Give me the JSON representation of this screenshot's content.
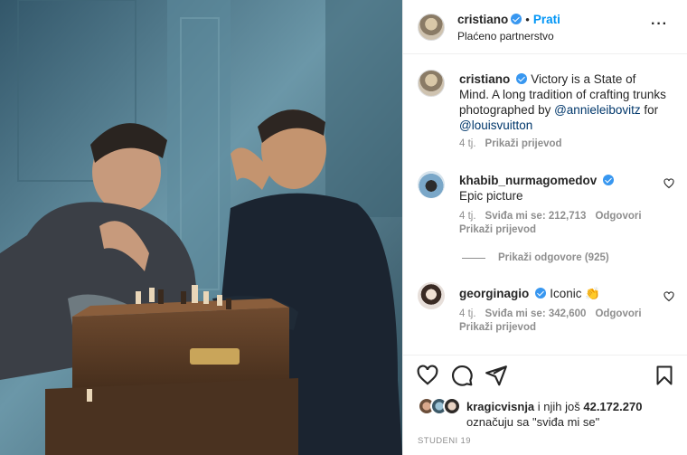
{
  "photo": {
    "alt_subject": "two chess players at a trunk chessboard",
    "colors": {
      "wall": "#4f7a8c",
      "trunk": "#5a3b26",
      "sweater_left": "#3b3f46",
      "sweater_right": "#1b2430"
    }
  },
  "header": {
    "username": "cristiano",
    "separator": "•",
    "follow_label": "Prati",
    "subtitle": "Plaćeno partnerstvo",
    "more_icon": "more-horizontal-icon"
  },
  "caption": {
    "username": "cristiano",
    "text_part1": "Victory is a State of Mind. A long tradition of crafting trunks photographed by ",
    "mention1": "@annieleibovitz",
    "text_part2": " for ",
    "mention2": "@louisvuitton",
    "time": "4 tj.",
    "translate": "Prikaži prijevod"
  },
  "comments": [
    {
      "username": "khabib_nurmagomedov",
      "text": "Epic picture",
      "time": "4 tj.",
      "likes": "Sviđa mi se: 212,713",
      "reply": "Odgovori",
      "translate": "Prikaži prijevod"
    },
    {
      "username": "georginagio",
      "text": "Iconic 👏",
      "time": "4 tj.",
      "likes": "Sviđa mi se: 342,600",
      "reply": "Odgovori",
      "translate": "Prikaži prijevod"
    }
  ],
  "view_replies": "Prikaži odgovore (925)",
  "likes": {
    "user": "kragicvisnja",
    "connector": " i njih još ",
    "count": "42.172.270",
    "suffix": "označuju sa \"sviđa mi se\""
  },
  "date": "STUDENI 19",
  "accent": "#0095f6"
}
